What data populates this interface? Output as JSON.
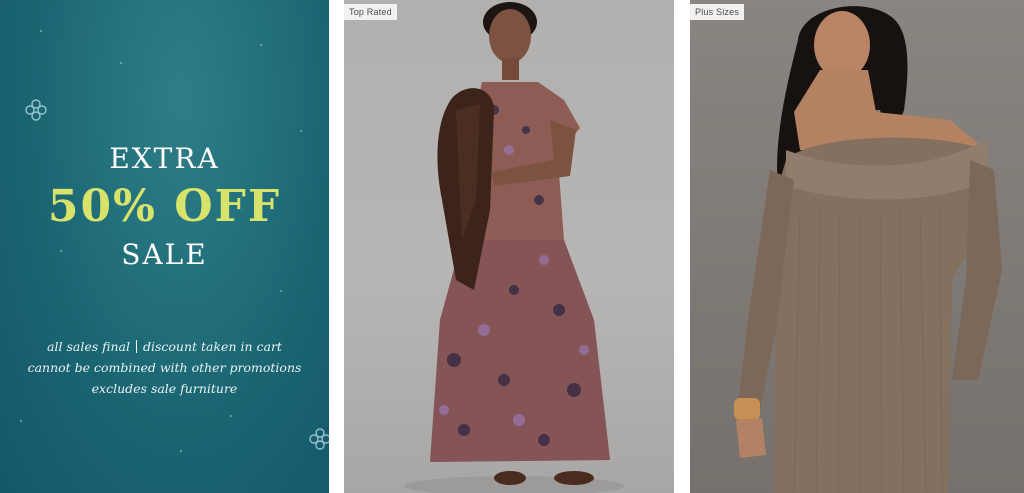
{
  "promo": {
    "line1": "EXTRA",
    "line2": "50% OFF",
    "line3": "SALE",
    "fine_part1": "all sales final",
    "fine_part2": "discount taken in cart",
    "fine_line2": "cannot be combined with other promotions",
    "fine_line3": "excludes sale furniture",
    "colors": {
      "background": "#1f6b78",
      "accent": "#d7e36a",
      "text": "#ffffff"
    }
  },
  "products": [
    {
      "badge": "Top Rated",
      "image": "model-floral-tiered-maxi-dress"
    },
    {
      "badge": "Plus Sizes",
      "image": "model-off-shoulder-knit-dress"
    }
  ]
}
